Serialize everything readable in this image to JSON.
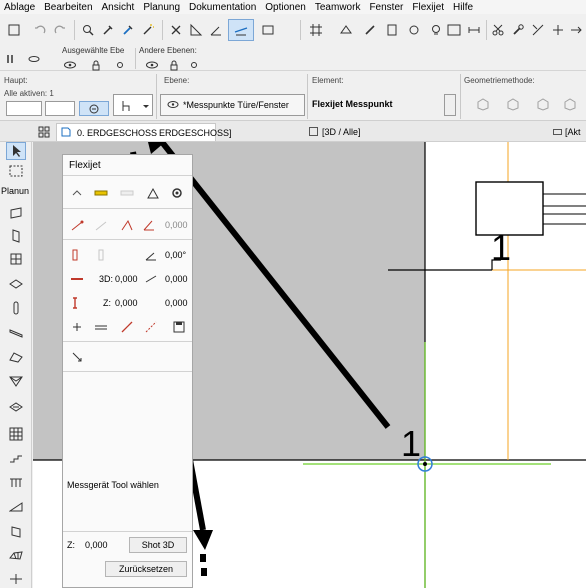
{
  "menu": [
    "Ablage",
    "Bearbeiten",
    "Ansicht",
    "Planung",
    "Dokumentation",
    "Optionen",
    "Teamwork",
    "Fenster",
    "Flexijet",
    "Hilfe"
  ],
  "layer_toolbar": {
    "selected_layer_label": "Ausgewählte Ebe",
    "other_layers_label": "Andere Ebenen:"
  },
  "info_box": {
    "haupt_label": "Haupt:",
    "alle_aktiven_label": "Alle aktiven: 1",
    "ebene_label": "Ebene:",
    "ebene_value": "*Messpunkte Türe/Fenster",
    "element_label": "Element:",
    "element_value": "Flexijet Messpunkt",
    "geometry_label": "Geometriemethode:"
  },
  "tabs": {
    "floor_tab": "0. ERDGESCHOSS",
    "floor_tab_2": "ERDGESCHOSS]",
    "view_3d_tab": "[3D / Alle]",
    "right_tab": "[Akt"
  },
  "left_tools": {
    "planung_label": "Planun"
  },
  "palette": {
    "title": "Flexijet",
    "field_value_1": "0,000",
    "angle_value": "0,00°",
    "label_3d": "3D:",
    "value_3d": "0,000",
    "value_3d_right": "0,000",
    "label_z": "Z:",
    "value_z": "0,000",
    "value_z_right": "0,000",
    "status_text": "Messgerät Tool wählen",
    "z_label": "Z:",
    "z_value": "0,000",
    "shot_3d_button": "Shot 3D",
    "reset_button": "Zurücksetzen"
  },
  "canvas": {
    "marker_label_upper": "1",
    "marker_label_lower": "1"
  },
  "colors": {
    "gray_area": "#c3c3c3",
    "orange_guide": "#f5a623",
    "green_guide": "#6ecf2a",
    "blue_marker": "#2f7ed8"
  }
}
